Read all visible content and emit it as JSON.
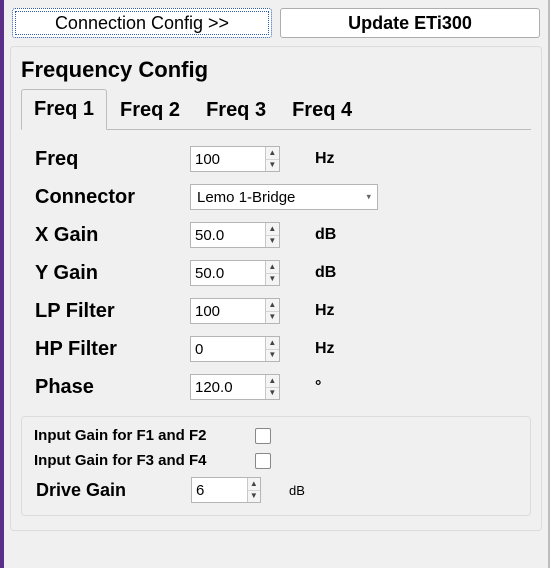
{
  "top_buttons": {
    "connection": "Connection Config >>",
    "update": "Update ETi300"
  },
  "group_title": "Frequency Config",
  "tabs": [
    "Freq 1",
    "Freq 2",
    "Freq 3",
    "Freq 4"
  ],
  "active_tab": 0,
  "fields": {
    "freq": {
      "label": "Freq",
      "value": "100",
      "unit": "Hz"
    },
    "connector": {
      "label": "Connector",
      "value": "Lemo 1-Bridge"
    },
    "xgain": {
      "label": "X Gain",
      "value": "50.0",
      "unit": "dB"
    },
    "ygain": {
      "label": "Y Gain",
      "value": "50.0",
      "unit": "dB"
    },
    "lp": {
      "label": "LP Filter",
      "value": "100",
      "unit": "Hz"
    },
    "hp": {
      "label": "HP Filter",
      "value": "0",
      "unit": "Hz"
    },
    "phase": {
      "label": "Phase",
      "value": "120.0",
      "unit": "°"
    }
  },
  "checks": {
    "f12": {
      "label": "Input Gain for F1 and F2",
      "checked": false
    },
    "f34": {
      "label": "Input Gain for F3 and F4",
      "checked": false
    }
  },
  "drive": {
    "label": "Drive Gain",
    "value": "6",
    "unit": "dB"
  }
}
